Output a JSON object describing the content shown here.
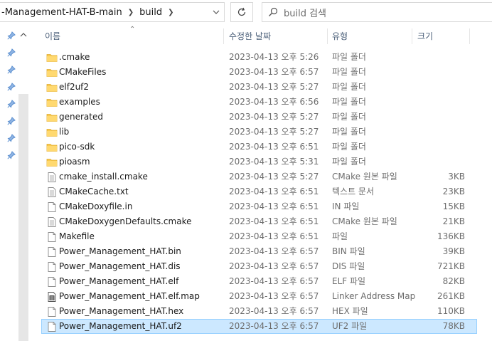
{
  "address": {
    "crumbs": [
      "-Management-HAT-B-main",
      "build"
    ]
  },
  "search": {
    "placeholder": "build 검색"
  },
  "columns": {
    "name": "이름",
    "date": "수정한 날짜",
    "type": "유형",
    "size": "크기"
  },
  "colors": {
    "folder": "#f8c94e",
    "selected_bg": "#cce8ff",
    "selected_border": "#99d1ff",
    "header_text": "#4c607a"
  },
  "files": [
    {
      "name": ".cmake",
      "date": "2023-04-13 오후 5:26",
      "type": "파일 폴더",
      "size": "",
      "icon": "folder-icon"
    },
    {
      "name": "CMakeFiles",
      "date": "2023-04-13 오후 6:57",
      "type": "파일 폴더",
      "size": "",
      "icon": "folder-icon"
    },
    {
      "name": "elf2uf2",
      "date": "2023-04-13 오후 5:27",
      "type": "파일 폴더",
      "size": "",
      "icon": "folder-icon"
    },
    {
      "name": "examples",
      "date": "2023-04-13 오후 6:56",
      "type": "파일 폴더",
      "size": "",
      "icon": "folder-icon"
    },
    {
      "name": "generated",
      "date": "2023-04-13 오후 5:27",
      "type": "파일 폴더",
      "size": "",
      "icon": "folder-icon"
    },
    {
      "name": "lib",
      "date": "2023-04-13 오후 5:27",
      "type": "파일 폴더",
      "size": "",
      "icon": "folder-icon"
    },
    {
      "name": "pico-sdk",
      "date": "2023-04-13 오후 6:51",
      "type": "파일 폴더",
      "size": "",
      "icon": "folder-icon"
    },
    {
      "name": "pioasm",
      "date": "2023-04-13 오후 5:31",
      "type": "파일 폴더",
      "size": "",
      "icon": "folder-icon"
    },
    {
      "name": "cmake_install.cmake",
      "date": "2023-04-13 오후 5:27",
      "type": "CMake 원본 파일",
      "size": "3KB",
      "icon": "text-file-icon"
    },
    {
      "name": "CMakeCache.txt",
      "date": "2023-04-13 오후 6:51",
      "type": "텍스트 문서",
      "size": "23KB",
      "icon": "text-file-icon"
    },
    {
      "name": "CMakeDoxyfile.in",
      "date": "2023-04-13 오후 6:51",
      "type": "IN 파일",
      "size": "15KB",
      "icon": "file-icon"
    },
    {
      "name": "CMakeDoxygenDefaults.cmake",
      "date": "2023-04-13 오후 6:51",
      "type": "CMake 원본 파일",
      "size": "21KB",
      "icon": "text-file-icon"
    },
    {
      "name": "Makefile",
      "date": "2023-04-13 오후 6:51",
      "type": "파일",
      "size": "136KB",
      "icon": "file-icon"
    },
    {
      "name": "Power_Management_HAT.bin",
      "date": "2023-04-13 오후 6:57",
      "type": "BIN 파일",
      "size": "39KB",
      "icon": "file-icon"
    },
    {
      "name": "Power_Management_HAT.dis",
      "date": "2023-04-13 오후 6:57",
      "type": "DIS 파일",
      "size": "721KB",
      "icon": "file-icon"
    },
    {
      "name": "Power_Management_HAT.elf",
      "date": "2023-04-13 오후 6:57",
      "type": "ELF 파일",
      "size": "82KB",
      "icon": "file-icon"
    },
    {
      "name": "Power_Management_HAT.elf.map",
      "date": "2023-04-13 오후 6:57",
      "type": "Linker Address Map",
      "size": "261KB",
      "icon": "map-file-icon"
    },
    {
      "name": "Power_Management_HAT.hex",
      "date": "2023-04-13 오후 6:57",
      "type": "HEX 파일",
      "size": "110KB",
      "icon": "file-icon"
    },
    {
      "name": "Power_Management_HAT.uf2",
      "date": "2023-04-13 오후 6:57",
      "type": "UF2 파일",
      "size": "78KB",
      "icon": "file-icon",
      "selected": true
    }
  ]
}
